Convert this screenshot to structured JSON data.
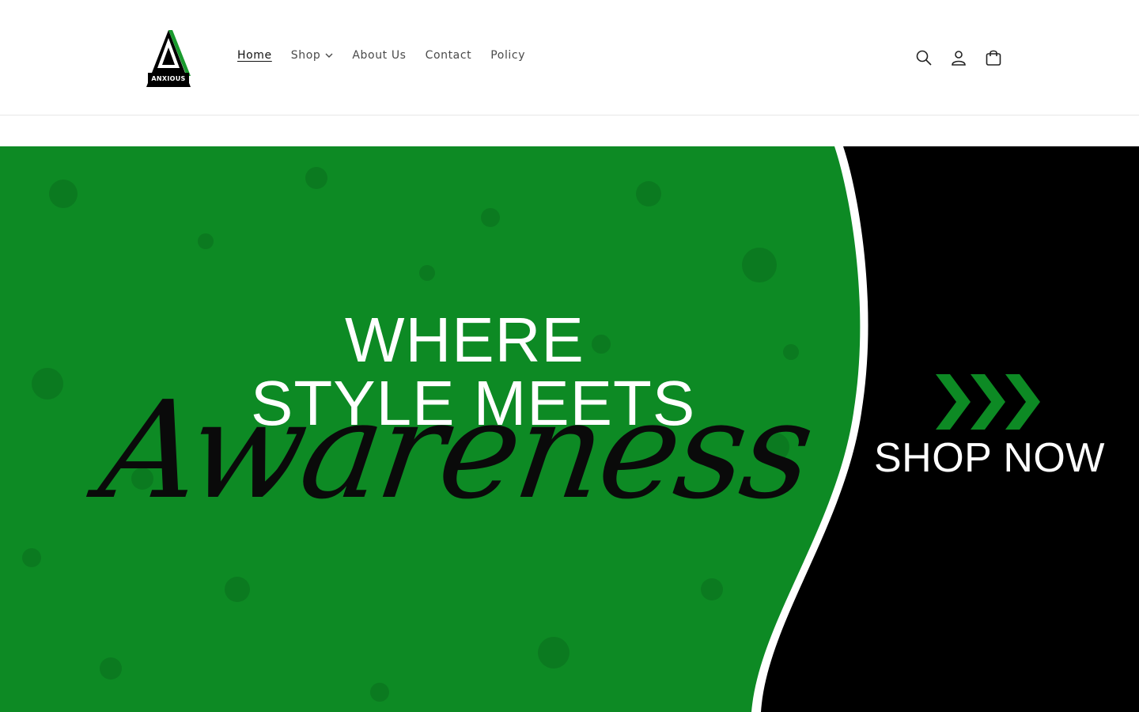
{
  "brand": {
    "name": "ANXIOUS",
    "logo_icon": "triangle-a-logo"
  },
  "nav": {
    "items": [
      {
        "label": "Home",
        "active": true
      },
      {
        "label": "Shop",
        "has_dropdown": true
      },
      {
        "label": "About Us"
      },
      {
        "label": "Contact"
      },
      {
        "label": "Policy"
      }
    ]
  },
  "header_icons": [
    "search-icon",
    "account-icon",
    "cart-icon"
  ],
  "hero": {
    "line1": "WHERE",
    "line2": "STYLE MEETS",
    "script": "Awareness",
    "cta": "SHOP NOW",
    "colors": {
      "green": "#0d8a24",
      "black": "#000000",
      "white": "#ffffff"
    }
  }
}
